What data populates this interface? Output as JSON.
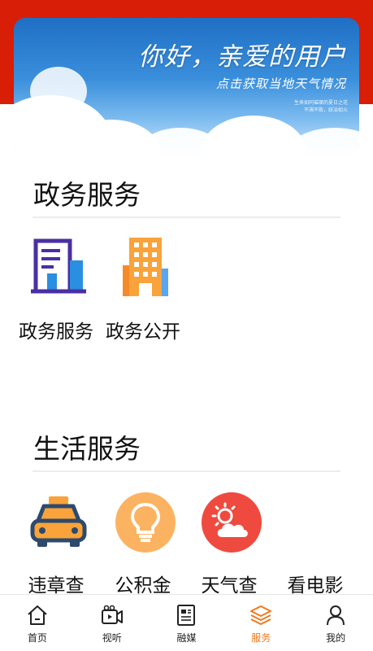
{
  "banner": {
    "title": "你好，亲爱的用户",
    "subtitle": "点击获取当地天气情况",
    "small_line_1": "生来如同璀璨的夏日之花",
    "small_line_2": "不凋不败，妖冶如火"
  },
  "gov_section": {
    "title": "政务服务",
    "items": [
      {
        "label": "政务服务",
        "icon": "building-chart-icon"
      },
      {
        "label": "政务公开",
        "icon": "office-buildings-icon"
      }
    ]
  },
  "life_section": {
    "title": "生活服务",
    "items": [
      {
        "label": "违章查",
        "icon": "taxi-icon"
      },
      {
        "label": "公积金",
        "icon": "lightbulb-icon"
      },
      {
        "label": "天气查",
        "icon": "weather-icon"
      },
      {
        "label": "看电影",
        "icon": ""
      }
    ]
  },
  "tabbar": {
    "active": "服务",
    "accent_color": "#f2781e",
    "items": [
      {
        "label": "首页",
        "icon": "home-icon"
      },
      {
        "label": "视听",
        "icon": "video-icon"
      },
      {
        "label": "融媒",
        "icon": "newspaper-icon"
      },
      {
        "label": "服务",
        "icon": "layers-icon"
      },
      {
        "label": "我的",
        "icon": "person-icon"
      }
    ]
  },
  "colors": {
    "header_red": "#d81e06",
    "purple": "#4a2fa3",
    "blue": "#2a8fe0",
    "orange": "#f9a33a",
    "light_orange": "#fcb361",
    "red_circle": "#ef4a3f"
  }
}
